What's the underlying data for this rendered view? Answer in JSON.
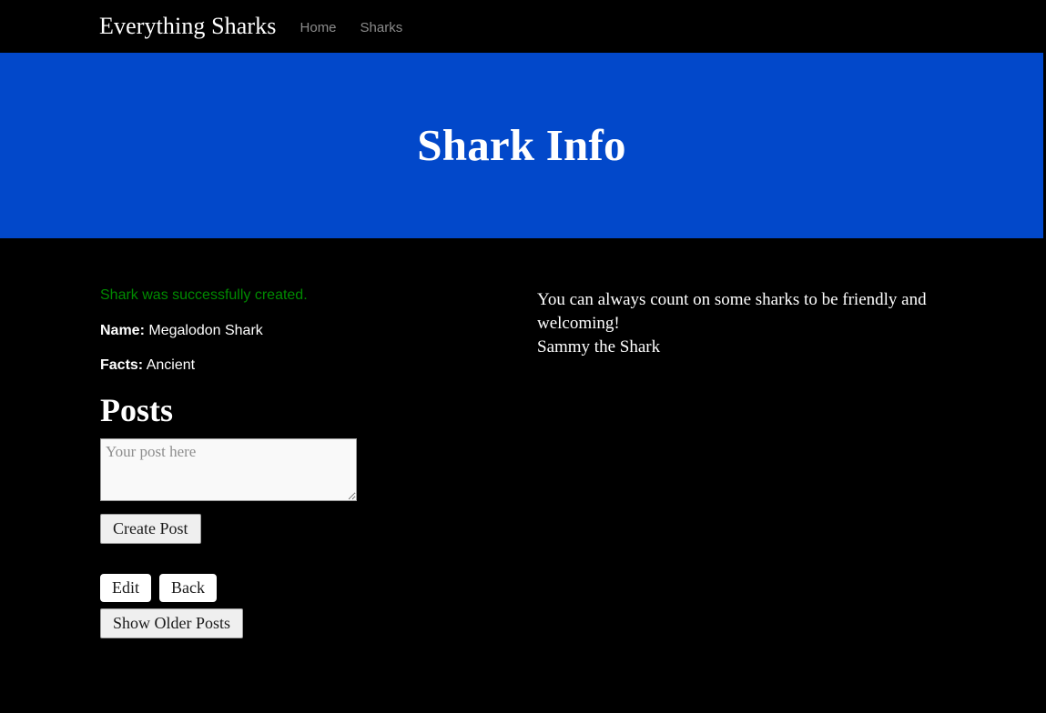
{
  "navbar": {
    "brand": "Everything Sharks",
    "links": [
      {
        "label": "Home"
      },
      {
        "label": "Sharks"
      }
    ]
  },
  "jumbotron": {
    "title": "Shark Info",
    "background_color": "#0248ca"
  },
  "main": {
    "notice": "Shark was successfully created.",
    "notice_color": "#008a00",
    "fields": [
      {
        "label": "Name:",
        "value": "Megalodon Shark"
      },
      {
        "label": "Facts:",
        "value": "Ancient"
      }
    ],
    "posts": {
      "heading": "Posts",
      "textarea_value": "",
      "textarea_placeholder": "Your post here",
      "create_button": "Create Post"
    },
    "actions": {
      "edit": "Edit",
      "back": "Back",
      "show_older": "Show Older Posts"
    }
  },
  "sidebar": {
    "quote_text": "You can always count on some sharks to be friendly and welcoming!",
    "quote_author": "Sammy the Shark"
  }
}
